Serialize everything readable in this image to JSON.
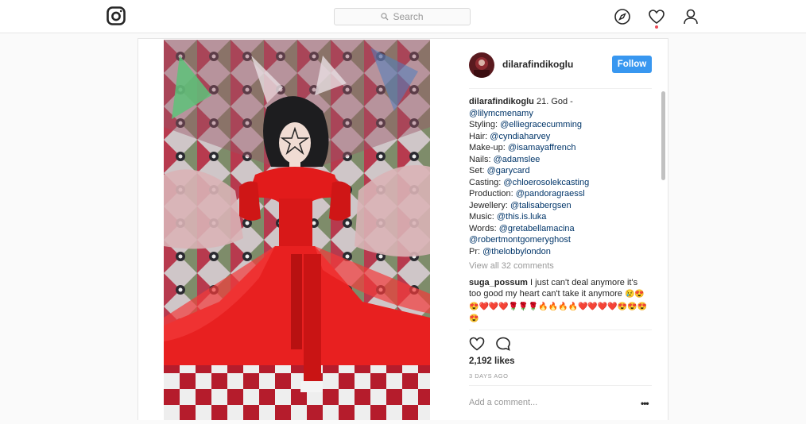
{
  "header": {
    "search_placeholder": "Search"
  },
  "post": {
    "username": "dilarafindikoglu",
    "follow_label": "Follow",
    "caption": {
      "username": "dilarafindikoglu",
      "first_text": "21. God -",
      "lines": [
        {
          "label": "",
          "mention": "@lilymcmenamy"
        },
        {
          "label": "Styling: ",
          "mention": "@elliegracecumming"
        },
        {
          "label": "Hair: ",
          "mention": "@cyndiaharvey"
        },
        {
          "label": "Make-up: ",
          "mention": "@isamayaffrench"
        },
        {
          "label": "Nails: ",
          "mention": "@adamslee"
        },
        {
          "label": "Set: ",
          "mention": "@garycard"
        },
        {
          "label": "Casting: ",
          "mention": "@chloerosolekcasting"
        },
        {
          "label": "Production: ",
          "mention": "@pandoragraessl"
        },
        {
          "label": "Jewellery: ",
          "mention": "@talisabergsen"
        },
        {
          "label": "Music: ",
          "mention": "@this.is.luka"
        },
        {
          "label": "Words: ",
          "mention": "@gretabellamacina"
        },
        {
          "label": "",
          "mention": "@robertmontgomeryghost"
        },
        {
          "label": "Pr: ",
          "mention": "@thelobbylondon"
        }
      ]
    },
    "view_all_comments": "View all 32 comments",
    "comment": {
      "username": "suga_possum",
      "text": "I just can't deal anymore it's too good my heart can't take it anymore",
      "emoji": "😢😍😍❤️❤️❤️🌹🌹🌹🔥🔥🔥🔥❤️❤️❤️❤️😍😍😍😍"
    },
    "likes": "2,192 likes",
    "posted_time": "3 DAYS AGO",
    "add_comment_placeholder": "Add a comment...",
    "more_label": "•••"
  },
  "icons": {
    "logo": "instagram-logo-icon",
    "search": "search-icon",
    "explore": "compass-icon",
    "activity": "heart-icon",
    "profile": "person-icon",
    "like": "heart-outline-icon",
    "comment": "comment-bubble-icon"
  },
  "colors": {
    "follow": "#3897f0",
    "mention": "#003569",
    "dress": "#e21b1b",
    "notification": "#ed4956"
  }
}
